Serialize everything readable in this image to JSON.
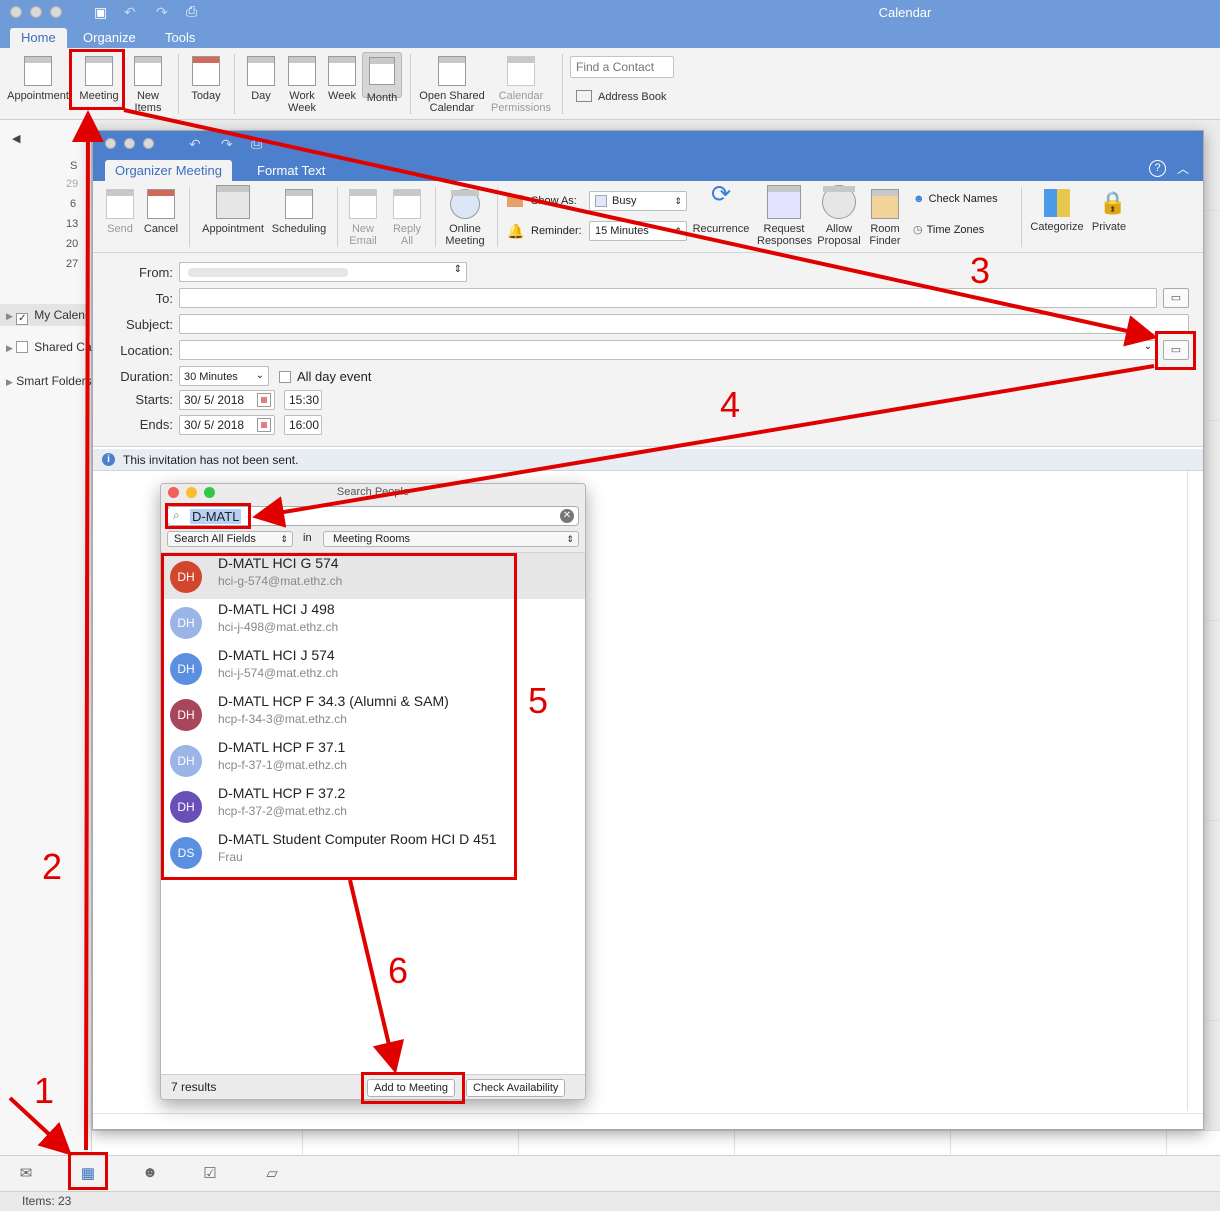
{
  "app": {
    "title": "Calendar"
  },
  "main_tabs": [
    "Home",
    "Organize",
    "Tools"
  ],
  "main_ribbon": {
    "appointment": "Appointment",
    "meeting": "Meeting",
    "new_items": "New Items",
    "today": "Today",
    "day": "Day",
    "work_week": "Work Week",
    "week": "Week",
    "month": "Month",
    "open_shared": "Open Shared Calendar",
    "cal_permissions": "Calendar Permissions",
    "find_contact_placeholder": "Find a Contact",
    "address_book": "Address Book"
  },
  "left_pane": {
    "mini_days": [
      "S",
      "29",
      "6",
      "13",
      "20",
      "27"
    ],
    "my_calendars": "My Calendars",
    "shared": "Shared Calendars",
    "smart_folders": "Smart Folders"
  },
  "status": {
    "items": "Items: 23"
  },
  "meeting_window": {
    "tabs": [
      "Organizer Meeting",
      "Format Text"
    ],
    "ribbon": {
      "send": "Send",
      "cancel": "Cancel",
      "appointment": "Appointment",
      "scheduling": "Scheduling",
      "new_email": "New Email",
      "reply_all": "Reply All",
      "online_meeting": "Online Meeting",
      "show_as_label": "Show As:",
      "show_as_value": "Busy",
      "reminder_label": "Reminder:",
      "reminder_value": "15 Minutes",
      "recurrence": "Recurrence",
      "request_responses": "Request Responses",
      "allow_proposal": "Allow Proposal",
      "room_finder": "Room Finder",
      "check_names": "Check Names",
      "time_zones": "Time Zones",
      "categorize": "Categorize",
      "private": "Private"
    },
    "form": {
      "from_label": "From:",
      "to_label": "To:",
      "subject_label": "Subject:",
      "location_label": "Location:",
      "duration_label": "Duration:",
      "duration_value": "30 Minutes",
      "all_day": "All day event",
      "starts_label": "Starts:",
      "start_date": "30/ 5/ 2018",
      "start_time": "15:30",
      "ends_label": "Ends:",
      "end_date": "30/ 5/ 2018",
      "end_time": "16:00"
    },
    "info": "This invitation has not been sent."
  },
  "search_people": {
    "title": "Search People",
    "query": "D-MATL",
    "field_scope": "Search All Fields",
    "in_label": "in",
    "directory": "Meeting Rooms",
    "results": [
      {
        "initials": "DH",
        "name": "D-MATL HCI G 574",
        "sub": "hci-g-574@mat.ethz.ch",
        "color": "#d2462e"
      },
      {
        "initials": "DH",
        "name": "D-MATL HCI J 498",
        "sub": "hci-j-498@mat.ethz.ch",
        "color": "#9ab5e6"
      },
      {
        "initials": "DH",
        "name": "D-MATL HCI J 574",
        "sub": "hci-j-574@mat.ethz.ch",
        "color": "#5b8fe0"
      },
      {
        "initials": "DH",
        "name": "D-MATL HCP F 34.3 (Alumni & SAM)",
        "sub": "hcp-f-34-3@mat.ethz.ch",
        "color": "#a8465c"
      },
      {
        "initials": "DH",
        "name": "D-MATL HCP F 37.1",
        "sub": "hcp-f-37-1@mat.ethz.ch",
        "color": "#9ab5e6"
      },
      {
        "initials": "DH",
        "name": "D-MATL HCP F 37.2",
        "sub": "hcp-f-37-2@mat.ethz.ch",
        "color": "#6a4fb8"
      },
      {
        "initials": "DS",
        "name": "D-MATL Student Computer Room HCI D 451",
        "sub": "Frau",
        "color": "#5b8fe0"
      }
    ],
    "count": "7 results",
    "add_button": "Add to Meeting",
    "check_button": "Check Availability"
  },
  "annotations": [
    "1",
    "2",
    "3",
    "4",
    "5",
    "6"
  ],
  "colors": {
    "annotation": "#e00000",
    "titlebar": "#6f9bd8",
    "meeting_titlebar": "#4d80cc"
  }
}
